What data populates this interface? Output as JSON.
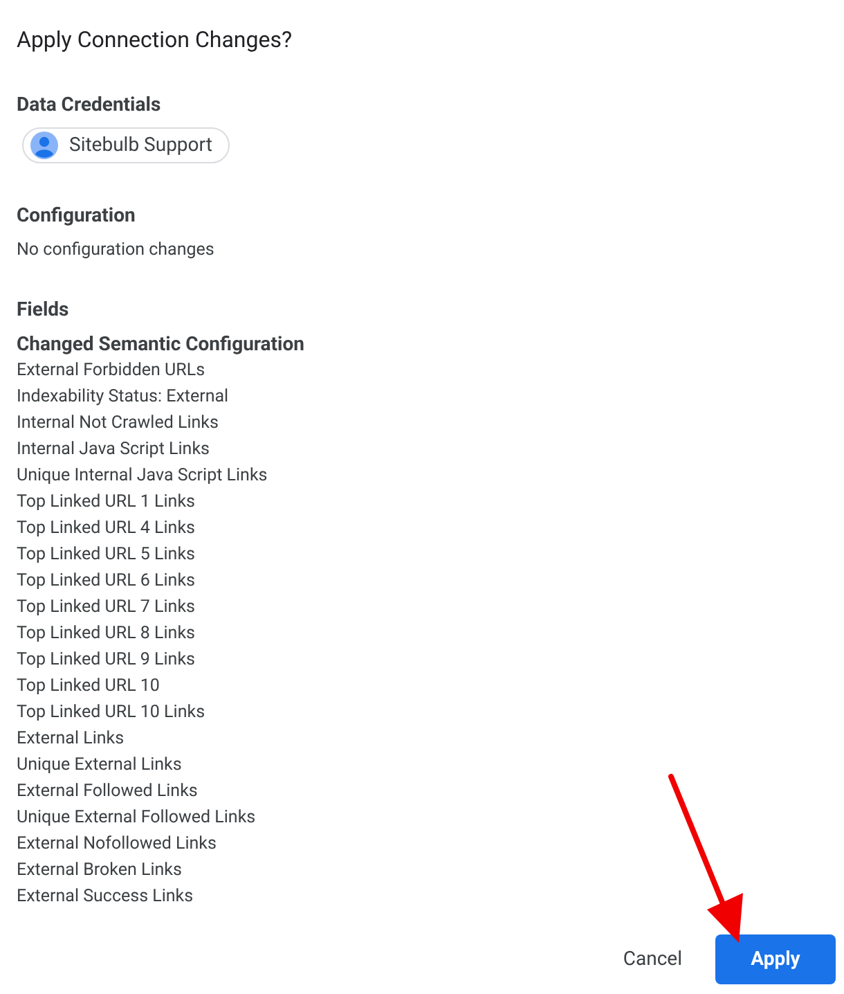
{
  "dialog": {
    "title": "Apply Connection Changes?",
    "credentials": {
      "heading": "Data Credentials",
      "account": "Sitebulb Support"
    },
    "configuration": {
      "heading": "Configuration",
      "text": "No configuration changes"
    },
    "fields": {
      "heading": "Fields",
      "subheading": "Changed Semantic Configuration",
      "items": [
        "External Forbidden URLs",
        "Indexability Status: External",
        "Internal Not Crawled Links",
        "Internal Java Script Links",
        "Unique Internal Java Script Links",
        "Top Linked URL 1 Links",
        "Top Linked URL 4 Links",
        "Top Linked URL 5 Links",
        "Top Linked URL 6 Links",
        "Top Linked URL 7 Links",
        "Top Linked URL 8 Links",
        "Top Linked URL 9 Links",
        "Top Linked URL 10",
        "Top Linked URL 10 Links",
        "External Links",
        "Unique External Links",
        "External Followed Links",
        "Unique External Followed Links",
        "External Nofollowed Links",
        "External Broken Links",
        "External Success Links"
      ]
    },
    "buttons": [
      {
        "label": "Cancel",
        "kind": "text"
      },
      {
        "label": "Apply",
        "kind": "primary"
      }
    ]
  }
}
